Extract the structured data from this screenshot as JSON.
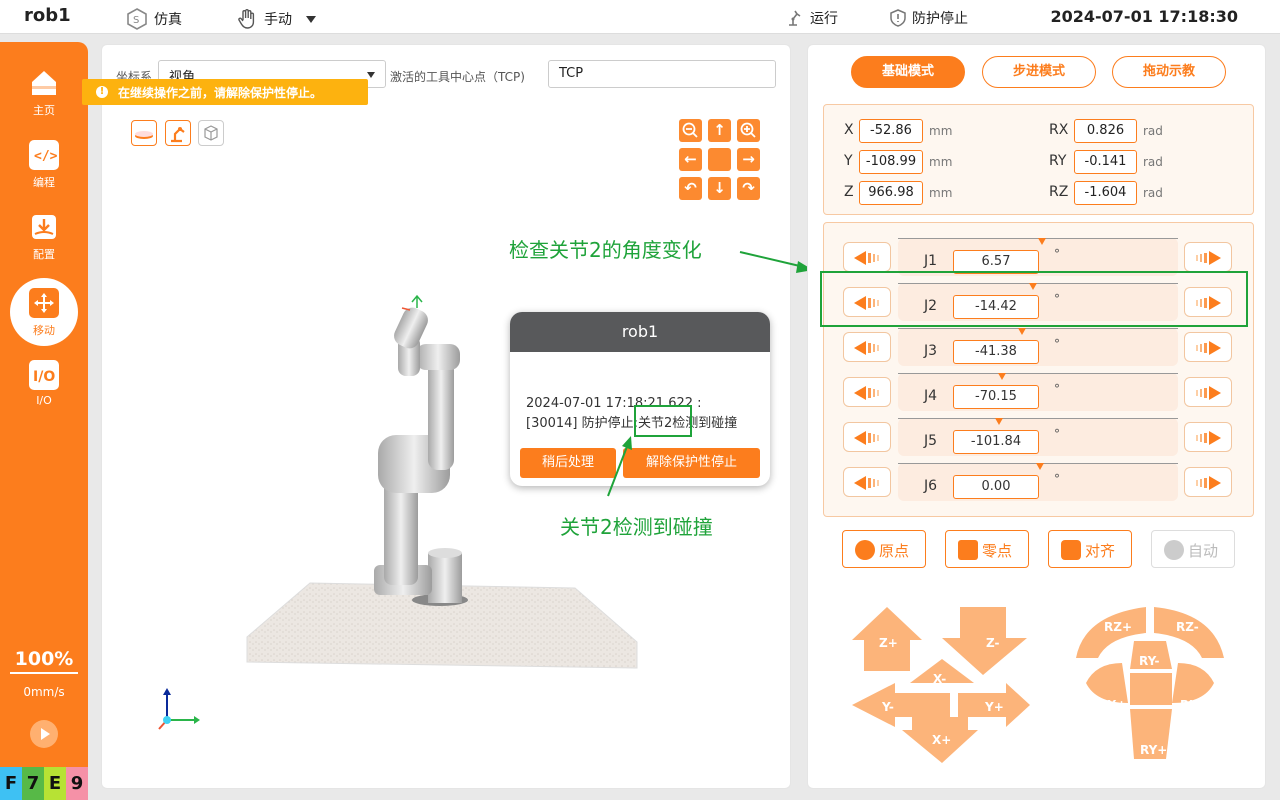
{
  "topbar": {
    "title": "rob1",
    "sim_label": "仿真",
    "mode_label": "手动",
    "run_label": "运行",
    "protect_label": "防护停止",
    "datetime": "2024-07-01 17:18:30"
  },
  "sidebar": {
    "items": [
      {
        "label": "主页",
        "icon": "home-icon"
      },
      {
        "label": "编程",
        "icon": "code-icon"
      },
      {
        "label": "配置",
        "icon": "config-icon"
      },
      {
        "label": "移动",
        "icon": "move-icon"
      },
      {
        "label": "I/O",
        "icon": "io-icon"
      }
    ],
    "speed_percent": "100%",
    "speed_value": "0mm/s",
    "fkeys": [
      "F",
      "7",
      "E",
      "9"
    ]
  },
  "view": {
    "coord_label": "坐标系",
    "coord_value": "视角",
    "tcp_label": "激活的工具中心点（TCP)",
    "tcp_value": "TCP",
    "warning": "在继续操作之前，请解除保护性停止。"
  },
  "dialog": {
    "title": "rob1",
    "line1": "2024-07-01 17:18:21.622 :",
    "line2": "[30014] 防护停止:关节2检测到碰撞",
    "later_label": "稍后处理",
    "release_label": "解除保护性停止"
  },
  "annotations": {
    "check_joint": "检查关节2的角度变化",
    "collision": "关节2检测到碰撞"
  },
  "modes": [
    "基础模式",
    "步进模式",
    "拖动示教"
  ],
  "coords": [
    {
      "name": "X",
      "value": "-52.86",
      "unit": "mm"
    },
    {
      "name": "Y",
      "value": "-108.99",
      "unit": "mm"
    },
    {
      "name": "Z",
      "value": "966.98",
      "unit": "mm"
    },
    {
      "name": "RX",
      "value": "0.826",
      "unit": "rad"
    },
    {
      "name": "RY",
      "value": "-0.141",
      "unit": "rad"
    },
    {
      "name": "RZ",
      "value": "-1.604",
      "unit": "rad"
    }
  ],
  "joints": [
    {
      "name": "J1",
      "value": "6.57",
      "unit": "°"
    },
    {
      "name": "J2",
      "value": "-14.42",
      "unit": "°"
    },
    {
      "name": "J3",
      "value": "-41.38",
      "unit": "°"
    },
    {
      "name": "J4",
      "value": "-70.15",
      "unit": "°"
    },
    {
      "name": "J5",
      "value": "-101.84",
      "unit": "°"
    },
    {
      "name": "J6",
      "value": "0.00",
      "unit": "°"
    }
  ],
  "actions": [
    "原点",
    "零点",
    "对齐",
    "自动"
  ],
  "jog": {
    "linear": [
      "Z+",
      "Z-",
      "X-",
      "Y-",
      "Y+",
      "X+"
    ],
    "rotary": [
      "RZ+",
      "RZ-",
      "RY-",
      "RX+",
      "RX-",
      "RY+"
    ]
  },
  "colors": {
    "accent": "#fc7d1d",
    "annotation": "#1fa33a",
    "warning": "#fdb20f"
  }
}
